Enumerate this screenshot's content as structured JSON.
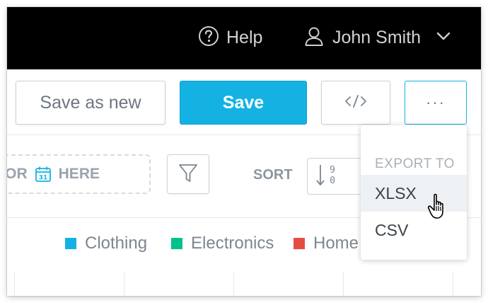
{
  "header": {
    "help_label": "Help",
    "user_name": "John Smith"
  },
  "toolbar": {
    "save_as_new_label": "Save as new",
    "save_label": "Save",
    "embed_label": "</>",
    "more_label": "···"
  },
  "filters": {
    "dropzone_or": "OR",
    "dropzone_here": "HERE",
    "calendar_day": "31",
    "sort_label": "SORT",
    "sort_icon_digits_top": "9",
    "sort_icon_digits_bottom": "0"
  },
  "legend": {
    "items": [
      {
        "label": "Clothing",
        "color": "#14b2e2"
      },
      {
        "label": "Electronics",
        "color": "#00c18d"
      },
      {
        "label": "Home",
        "color": "#e54d42"
      }
    ]
  },
  "export_menu": {
    "header": "EXPORT TO",
    "items": [
      "XLSX",
      "CSV"
    ],
    "hovered": "XLSX"
  },
  "colors": {
    "accent": "#14b2e2",
    "topbar": "#000000"
  },
  "icons": {
    "help": "question-circle-icon",
    "user": "user-icon",
    "chevron": "chevron-down-icon",
    "filter": "funnel-icon",
    "calendar": "calendar-icon",
    "sort": "sort-numeric-icon",
    "cursor": "hand-pointer-cursor"
  }
}
